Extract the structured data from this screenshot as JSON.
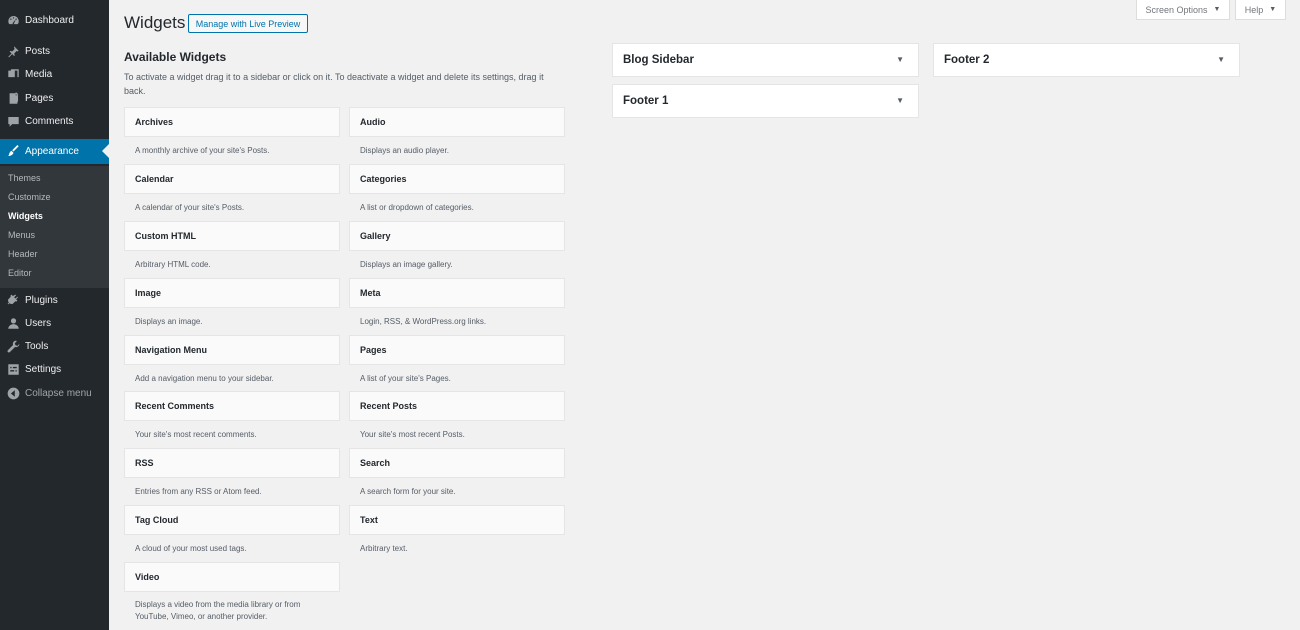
{
  "sidebar_menu": {
    "dashboard": "Dashboard",
    "posts": "Posts",
    "media": "Media",
    "pages": "Pages",
    "comments": "Comments",
    "appearance": "Appearance",
    "plugins": "Plugins",
    "users": "Users",
    "tools": "Tools",
    "settings": "Settings",
    "collapse": "Collapse menu"
  },
  "submenu": {
    "themes": "Themes",
    "customize": "Customize",
    "widgets": "Widgets",
    "menus": "Menus",
    "header": "Header",
    "editor": "Editor"
  },
  "header": {
    "title": "Widgets",
    "live_preview": "Manage with Live Preview",
    "screen_options": "Screen Options",
    "help": "Help"
  },
  "available": {
    "title": "Available Widgets",
    "description": "To activate a widget drag it to a sidebar or click on it. To deactivate a widget and delete its settings, drag it back.",
    "widgets": [
      {
        "name": "Archives",
        "desc": "A monthly archive of your site's Posts."
      },
      {
        "name": "Audio",
        "desc": "Displays an audio player."
      },
      {
        "name": "Calendar",
        "desc": "A calendar of your site's Posts."
      },
      {
        "name": "Categories",
        "desc": "A list or dropdown of categories."
      },
      {
        "name": "Custom HTML",
        "desc": "Arbitrary HTML code."
      },
      {
        "name": "Gallery",
        "desc": "Displays an image gallery."
      },
      {
        "name": "Image",
        "desc": "Displays an image."
      },
      {
        "name": "Meta",
        "desc": "Login, RSS, & WordPress.org links."
      },
      {
        "name": "Navigation Menu",
        "desc": "Add a navigation menu to your sidebar."
      },
      {
        "name": "Pages",
        "desc": "A list of your site's Pages."
      },
      {
        "name": "Recent Comments",
        "desc": "Your site's most recent comments."
      },
      {
        "name": "Recent Posts",
        "desc": "Your site's most recent Posts."
      },
      {
        "name": "RSS",
        "desc": "Entries from any RSS or Atom feed."
      },
      {
        "name": "Search",
        "desc": "A search form for your site."
      },
      {
        "name": "Tag Cloud",
        "desc": "A cloud of your most used tags."
      },
      {
        "name": "Text",
        "desc": "Arbitrary text."
      },
      {
        "name": "Video",
        "desc": "Displays a video from the media library or from YouTube, Vimeo, or another provider."
      }
    ]
  },
  "sidebars": {
    "blog_sidebar": "Blog Sidebar",
    "footer_1": "Footer 1",
    "footer_2": "Footer 2"
  },
  "icons": {
    "dashboard": "dashboard-icon",
    "posts": "pin-icon",
    "media": "media-icon",
    "pages": "pages-icon",
    "comments": "comment-icon",
    "appearance": "brush-icon",
    "plugins": "plugin-icon",
    "users": "user-icon",
    "tools": "wrench-icon",
    "settings": "settings-icon",
    "collapse": "collapse-icon",
    "dropdown": "triangle-down-icon"
  },
  "colors": {
    "menu_bg": "#23282d",
    "submenu_bg": "#32373c",
    "accent": "#0073aa",
    "page_bg": "#f1f1f1"
  }
}
